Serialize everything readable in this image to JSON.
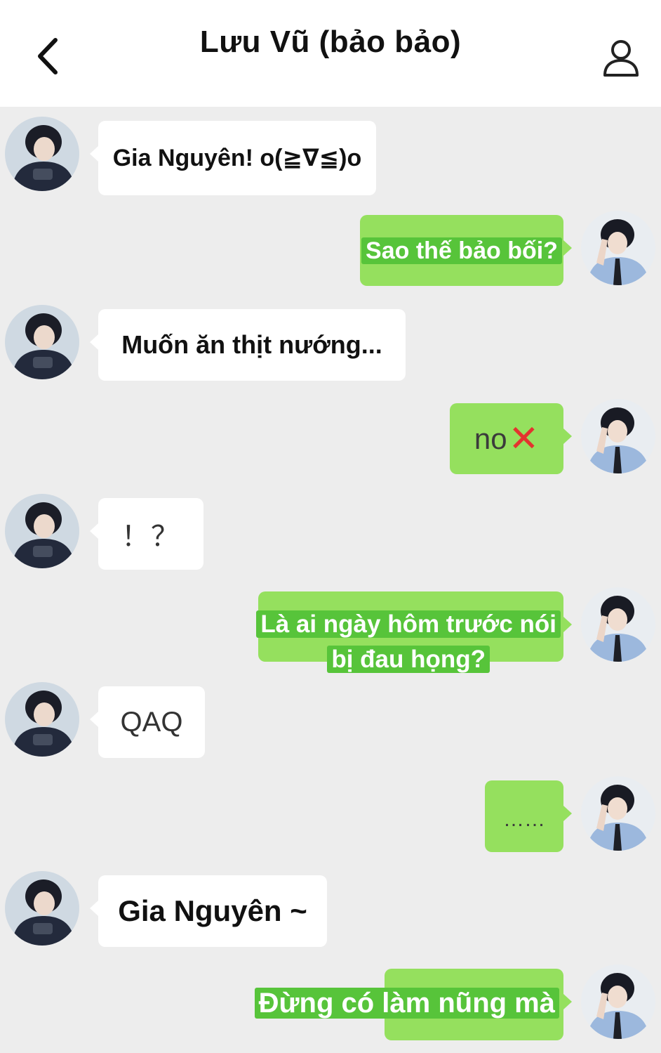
{
  "header": {
    "title": "Lưu Vũ (bảo bảo)",
    "back_icon": "chevron-left-icon",
    "profile_icon": "user-icon"
  },
  "colors": {
    "background": "#ededed",
    "incoming_bubble": "#ffffff",
    "outgoing_bubble": "#95e05e",
    "text_highlight": "#57c43a"
  },
  "messages": [
    {
      "side": "in",
      "text": "Gia Nguyên! o(≧∇≦)o"
    },
    {
      "side": "out",
      "text": "Sao thế bảo bối?"
    },
    {
      "side": "in",
      "text": "Muốn ăn thịt nướng..."
    },
    {
      "side": "out",
      "text": "no",
      "emoji": "cross-mark-icon"
    },
    {
      "side": "in",
      "text": "！？"
    },
    {
      "side": "out",
      "lines": [
        "Là ai ngày hôm trước nói",
        "bị đau họng?"
      ]
    },
    {
      "side": "in",
      "text": "QAQ"
    },
    {
      "side": "out",
      "text": "……"
    },
    {
      "side": "in",
      "text": "Gia Nguyên ~"
    },
    {
      "side": "out",
      "text": "Đừng có làm nũng mà"
    }
  ]
}
